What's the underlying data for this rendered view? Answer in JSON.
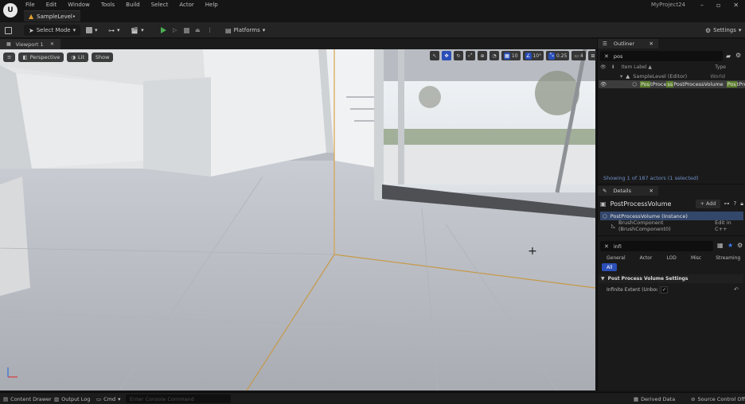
{
  "title_bar": {
    "menu": [
      "File",
      "Edit",
      "Window",
      "Tools",
      "Build",
      "Select",
      "Actor",
      "Help"
    ],
    "level_tab_label": "SampleLevel•",
    "project_name": "MyProject24",
    "window_controls": [
      "–",
      "▫",
      "✕"
    ]
  },
  "toolbar": {
    "select_mode_label": "Select Mode",
    "platforms_label": "Platforms",
    "settings_label": "Settings",
    "play_color": "#4caf50"
  },
  "viewport": {
    "tab_label": "Viewport 1",
    "menu_icon": "≡",
    "perspective_label": "Perspective",
    "lit_label": "Lit",
    "show_label": "Show",
    "snap_grid_value": "10",
    "rotation_snap_value": "10°",
    "scale_snap_value": "0.25",
    "camera_speed_value": "4",
    "accent_color": "#2b4fb8",
    "crosshair_glyph": "+"
  },
  "outliner": {
    "tab_label": "Outliner",
    "search_value": "pos",
    "column_item_label": "Item Label ▲",
    "column_type": "Type",
    "rows": [
      {
        "label": "SampleLevel (Editor)",
        "type": "World"
      },
      {
        "label_parts": [
          "Pos",
          "tProce",
          "ss",
          "Pos",
          "tProcessVolume"
        ],
        "type_parts": [
          "Pos",
          "tProcessV"
        ]
      }
    ],
    "status": "Showing 1 of 187 actors (1 selected)"
  },
  "details": {
    "tab_label": "Details",
    "actor_name": "PostProcessVolume",
    "add_button": "+ Add",
    "component_instance": "PostProcessVolume (Instance)",
    "component_child": "BrushComponent (BrushComponent0)",
    "edit_in_cpp": "Edit in C++",
    "search_value": "infi",
    "category_tabs": [
      "General",
      "Actor",
      "LOD",
      "Misc",
      "Streaming"
    ],
    "all_tab": "All",
    "section_title": "Post Process Volume Settings",
    "property_label": "Infinite Extent (Unboun...",
    "property_checked": true,
    "reset_icon": "↶"
  },
  "status_bar": {
    "content_drawer": "Content Drawer",
    "output_log": "Output Log",
    "cmd_label": "Cmd",
    "console_placeholder": "Enter Console Command",
    "derived_data": "Derived Data",
    "source_control": "Source Control Off"
  }
}
